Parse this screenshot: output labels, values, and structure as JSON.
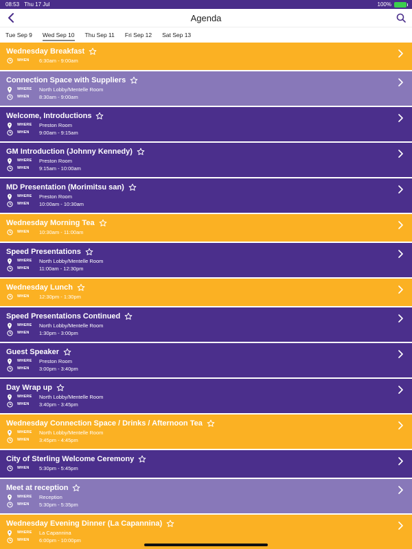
{
  "status": {
    "time": "08:53",
    "date": "Thu 17 Jul",
    "battery": "100%"
  },
  "nav": {
    "title": "Agenda"
  },
  "tabs": [
    {
      "label": "Tue Sep 9"
    },
    {
      "label": "Wed Sep 10",
      "active": true
    },
    {
      "label": "Thu Sep 11"
    },
    {
      "label": "Fri Sep 12"
    },
    {
      "label": "Sat Sep 13"
    }
  ],
  "labels": {
    "where": "WHERE",
    "when": "WHEN"
  },
  "colors": {
    "orange": "#fbb123",
    "purple": "#4b2f8c",
    "lavender": "#8878b9"
  },
  "events": [
    {
      "title": "Wednesday Breakfast",
      "where": "",
      "when": "6:30am - 9:00am",
      "color": "orange"
    },
    {
      "title": "Connection Space with Suppliers",
      "where": "North Lobby/Mentelle Room",
      "when": "8:30am - 9:00am",
      "color": "lavender"
    },
    {
      "title": "Welcome, Introductions",
      "where": "Preston Room",
      "when": "9:00am - 9:15am",
      "color": "purple"
    },
    {
      "title": "GM Introduction (Johnny Kennedy)",
      "where": "Preston Room",
      "when": "9:15am - 10:00am",
      "color": "purple"
    },
    {
      "title": "MD Presentation (Morimitsu san)",
      "where": "Preston Room",
      "when": "10:00am - 10:30am",
      "color": "purple"
    },
    {
      "title": "Wednesday Morning Tea",
      "where": "",
      "when": "10:30am - 11:00am",
      "color": "orange"
    },
    {
      "title": "Speed Presentations",
      "where": "North Lobby/Mentelle Room",
      "when": "11:00am - 12:30pm",
      "color": "purple"
    },
    {
      "title": "Wednesday Lunch",
      "where": "",
      "when": "12:30pm - 1:30pm",
      "color": "orange"
    },
    {
      "title": "Speed Presentations Continued",
      "where": "North Lobby/Mentelle Room",
      "when": "1:30pm - 3:00pm",
      "color": "purple"
    },
    {
      "title": "Guest Speaker",
      "where": "Preston Room",
      "when": "3:00pm - 3:40pm",
      "color": "purple"
    },
    {
      "title": "Day Wrap up",
      "where": "North Lobby/Mentelle Room",
      "when": "3:40pm - 3:45pm",
      "color": "purple"
    },
    {
      "title": "Wednesday Connection Space / Drinks / Afternoon Tea",
      "where": "North Lobby/Mentelle Room",
      "when": "3:45pm - 4:45pm",
      "color": "orange"
    },
    {
      "title": "City of Sterling Welcome Ceremony",
      "where": "",
      "when": "5:30pm - 5:45pm",
      "color": "purple"
    },
    {
      "title": "Meet at reception",
      "where": "Reception",
      "when": "5:30pm - 5:35pm",
      "color": "lavender"
    },
    {
      "title": "Wednesday Evening Dinner (La Capannina)",
      "where": "La Capannina",
      "when": "6:00pm - 10:00pm",
      "color": "orange"
    }
  ]
}
